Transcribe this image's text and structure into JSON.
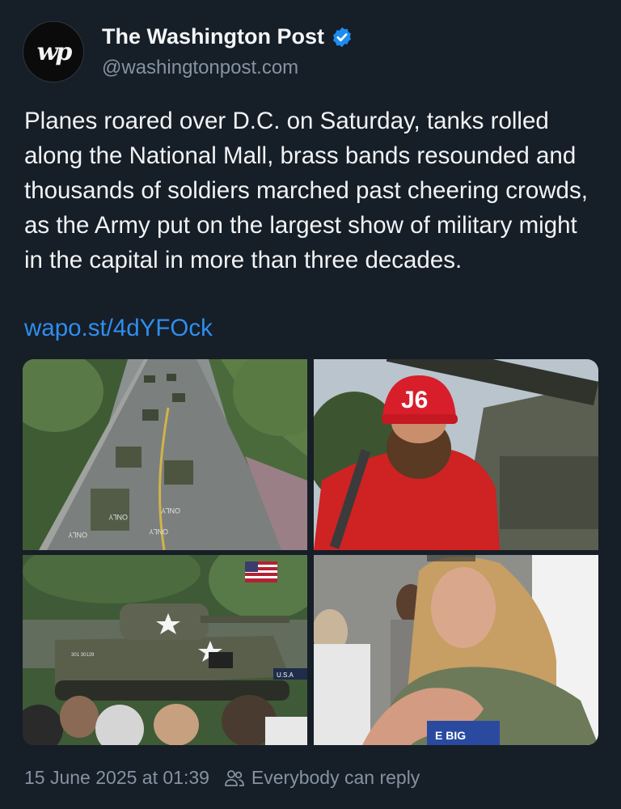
{
  "author": {
    "name": "The Washington Post",
    "handle": "@washingtonpost.com",
    "avatar_text": "wp",
    "verified_icon": "verified-badge-icon"
  },
  "post": {
    "text": "Planes roared over D.C. on Saturday, tanks rolled along the National Mall, brass bands resounded and thousands of soldiers marched past cheering crowds, as the Army put on the largest show of military might in the capital in more than three decades.",
    "link": "wapo.st/4dYFOck"
  },
  "images": {
    "cap_text": "J6",
    "tank_marking": "301 30129",
    "banner_text": "U.S.A",
    "road_markings": [
      "ONLY",
      "ONLY",
      "ONLY",
      "ONLY"
    ],
    "shirt_text": "E BIG"
  },
  "footer": {
    "timestamp": "15 June 2025 at 01:39",
    "reply_setting": "Everybody can reply",
    "reply_icon": "people-icon"
  },
  "colors": {
    "background": "#161e27",
    "link": "#2f8eef",
    "muted": "#8593a2",
    "verified": "#1d8cf0"
  }
}
